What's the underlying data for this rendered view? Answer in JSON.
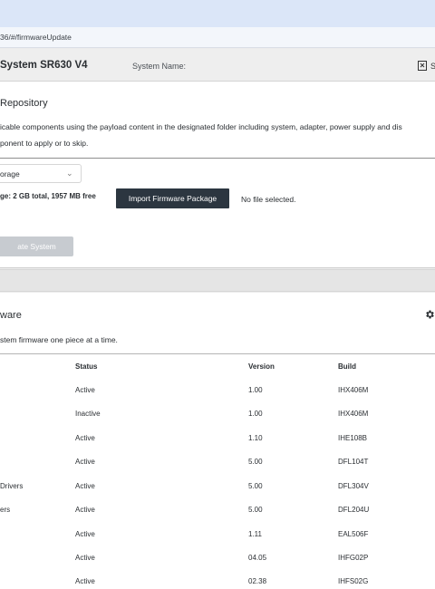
{
  "browser": {
    "url": "36/#/firmwareUpdate"
  },
  "header": {
    "title": "System SR630 V4",
    "system_name_label": "System Name:",
    "right_label": "S"
  },
  "repository": {
    "title": "Repository",
    "desc_line1": "icable components using the payload content in the designated folder including system, adapter, power supply and dis",
    "desc_line2": "ponent to apply or to skip.",
    "storage_select": "orage",
    "storage_info": "ge: 2 GB total, 1957 MB free",
    "import_button": "Import Firmware Package",
    "file_status": "No file selected.",
    "update_button": "ate System"
  },
  "firmware": {
    "title": "ware",
    "desc": "stem firmware one piece at a time.",
    "columns": {
      "status": "Status",
      "version": "Version",
      "build": "Build"
    },
    "rows": [
      {
        "name": "",
        "status": "Active",
        "version": "1.00",
        "build": "IHX406M"
      },
      {
        "name": "",
        "status": "Inactive",
        "version": "1.00",
        "build": "IHX406M"
      },
      {
        "name": "",
        "status": "Active",
        "version": "1.10",
        "build": "IHE108B"
      },
      {
        "name": "",
        "status": "Active",
        "version": "5.00",
        "build": "DFL104T"
      },
      {
        "name": "Drivers",
        "status": "Active",
        "version": "5.00",
        "build": "DFL304V"
      },
      {
        "name": "ers",
        "status": "Active",
        "version": "5.00",
        "build": "DFL204U"
      },
      {
        "name": "",
        "status": "Active",
        "version": "1.11",
        "build": "EAL506F"
      },
      {
        "name": "",
        "status": "Active",
        "version": "04.05",
        "build": "IHFG02P"
      },
      {
        "name": "",
        "status": "Active",
        "version": "02.38",
        "build": "IHFS02G"
      }
    ]
  }
}
